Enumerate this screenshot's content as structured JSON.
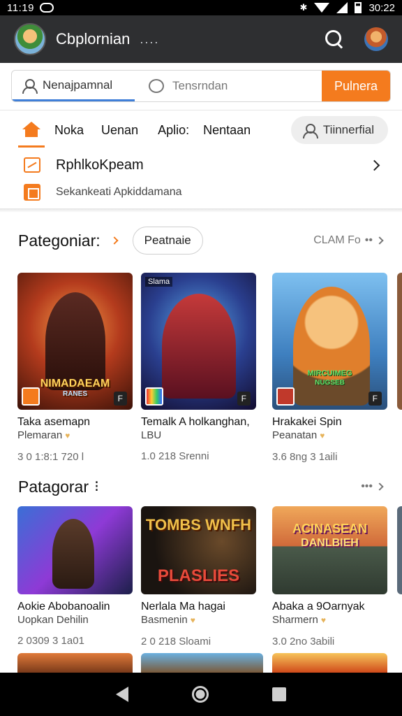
{
  "status_bar": {
    "time_left": "11:19",
    "time_right": "30:22"
  },
  "app_bar": {
    "title": "Cbplornian",
    "dots": "...."
  },
  "search": {
    "field1": "Nenajpamnal",
    "field2": "Tensrndan",
    "button": "Pulnera"
  },
  "tabs": {
    "items": [
      "Noka",
      "Uenan",
      "Aplio:",
      "Nentaan"
    ],
    "pill": "Tiinnerfial"
  },
  "promo": {
    "title": "RphlkoKpeam",
    "subtitle": "Sekankeati Apkiddamana"
  },
  "section1": {
    "title": "Pategoniar:",
    "chip": "Peatnaie",
    "see_more": "CLAM Fo",
    "cards": [
      {
        "title": "Taka asemapn",
        "sub": "Plemaran",
        "meta": "3 0 1:8:1 720 l",
        "art": "NIMADAEAM",
        "art_sub": "RANES",
        "tag": "F"
      },
      {
        "title": "Temalk A holkanghan,",
        "sub": "LBU",
        "meta": "1.0 218 Srenni",
        "art": "",
        "art_sub": "",
        "corner": "Slama",
        "tag": "F"
      },
      {
        "title": "Hrakakei Spin",
        "sub": "Peanatan",
        "meta": "3.6 8ng 3 1aili",
        "art": "MIRCUIMEG",
        "art_sub": "NUGSEB",
        "tag": "F"
      }
    ]
  },
  "section2": {
    "title": "Patagorar",
    "more": "•••",
    "cards": [
      {
        "title": "Aokie Abobanoalin",
        "sub": "Uopkan Dehilin",
        "meta": "2 0309 3 1a01",
        "art": ""
      },
      {
        "title": "Nerlala Ma hagai",
        "sub": "Basmenin",
        "meta": "2 0 218 Sloami",
        "art": "TOMBS WNFH",
        "art_sub": "PLASLIES"
      },
      {
        "title": "Abaka a 9Oarnyak",
        "sub": "Sharmern",
        "meta": "3.0 2no 3abili",
        "art": "ACINASEAN",
        "art_sub": "DANLBIEH"
      }
    ]
  },
  "colors": {
    "accent": "#f47b1e",
    "appbar": "#2e2f31",
    "link": "#3f7fd8"
  },
  "icons": [
    "search-icon",
    "user-icon",
    "chat-icon",
    "home-icon",
    "chevron-right-icon",
    "back-icon",
    "home-circle-icon",
    "recents-icon"
  ]
}
